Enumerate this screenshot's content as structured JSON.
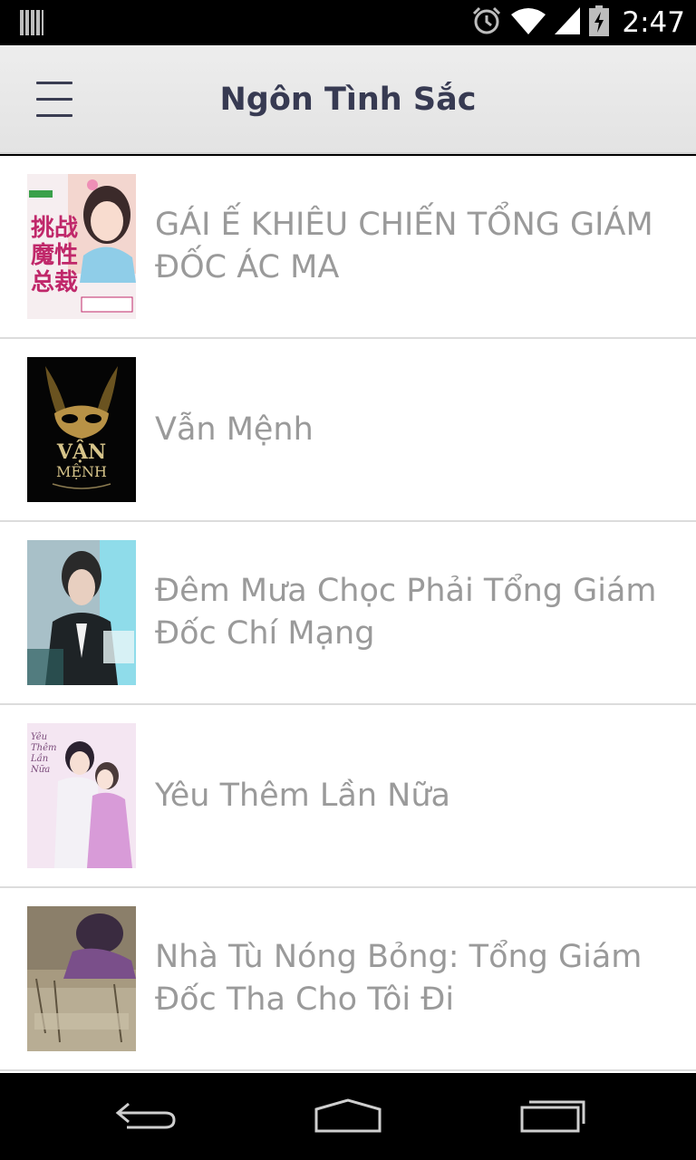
{
  "status_bar": {
    "time": "2:47",
    "icons": [
      "notification-icon",
      "alarm-icon",
      "wifi-icon",
      "signal-icon",
      "battery-icon"
    ]
  },
  "app_bar": {
    "title": "Ngôn Tình Sắc",
    "menu_icon": "hamburger-menu-icon"
  },
  "books": [
    {
      "title": "GÁI Ế KHIÊU CHIẾN TỔNG GIÁM ĐỐC ÁC MA",
      "cover": "cover-gai-e-khieu-chien"
    },
    {
      "title": "Vẫn Mệnh",
      "cover": "cover-van-menh"
    },
    {
      "title": "Đêm Mưa Chọc Phải Tổng Giám Đốc Chí Mạng",
      "cover": "cover-dem-mua"
    },
    {
      "title": "Yêu Thêm Lần Nữa",
      "cover": "cover-yeu-them-lan-nua"
    },
    {
      "title": "Nhà Tù Nóng Bỏng: Tổng Giám Đốc Tha Cho Tôi Đi",
      "cover": "cover-nha-tu-nong-bong"
    }
  ],
  "nav_bar": {
    "icons": [
      "back-icon",
      "home-icon",
      "recent-apps-icon"
    ]
  },
  "colors": {
    "app_bar_bg": "#e8e8e8",
    "title_color": "#373a52",
    "item_text": "#9a9a9a",
    "divider": "#dcdcdc"
  }
}
